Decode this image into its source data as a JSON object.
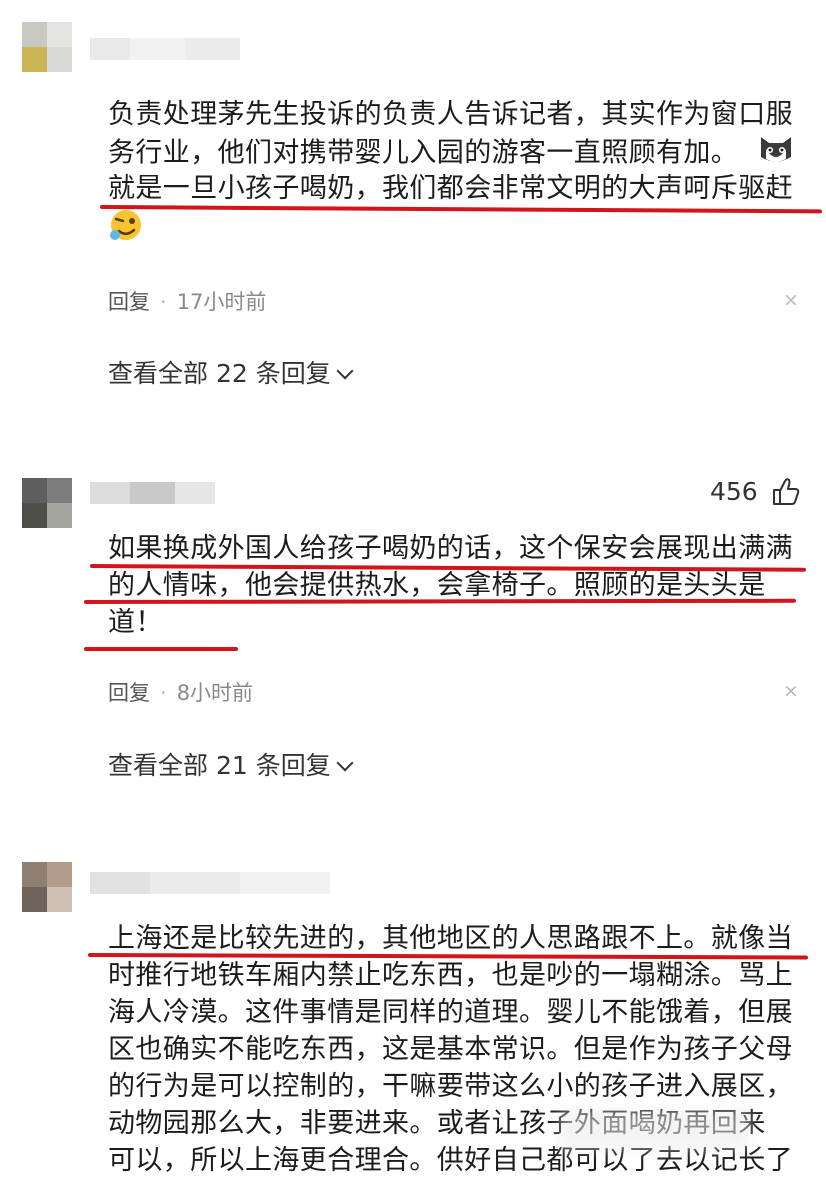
{
  "comments": [
    {
      "lines": [
        "负责处理茅先生投诉的负责人告诉记者，其实作为窗口服",
        "务行业，他们对携带婴儿入园的游客一直照顾有加。",
        "就是一旦小孩子喝奶，我们都会非常文明的大声呵斥驱赶"
      ],
      "emoji_icons": [
        "cat-face-icon",
        "winking-smile-icon"
      ],
      "reply_label": "回复",
      "time": "17小时前",
      "close_glyph": "×",
      "view_all": "查看全部 22 条回复"
    },
    {
      "likes": "456",
      "lines": [
        "如果换成外国人给孩子喝奶的话，这个保安会展现出满满",
        "的人情味，他会提供热水，会拿椅子。照顾的是头头是",
        "道！"
      ],
      "reply_label": "回复",
      "time": "8小时前",
      "close_glyph": "×",
      "view_all": "查看全部 21 条回复"
    },
    {
      "lines": [
        "上海还是比较先进的，其他地区的人思路跟不上。就像当",
        "时推行地铁车厢内禁止吃东西，也是吵的一塌糊涂。骂上",
        "海人冷漠。这件事情是同样的道理。婴儿不能饿着，但展",
        "区也确实不能吃东西，这是基本常识。但是作为孩子父母",
        "的行为是可以控制的，干嘛要带这么小的孩子进入展区，",
        "动物园那么大，非要进来。或者让孩子外面喝奶再回来",
        "可以，所以上海更合理合。供好自己都可以了去以记长了"
      ]
    }
  ],
  "colors": {
    "underline": "#d2151b",
    "text": "#1c1c1c",
    "meta": "#8a8a8a"
  }
}
